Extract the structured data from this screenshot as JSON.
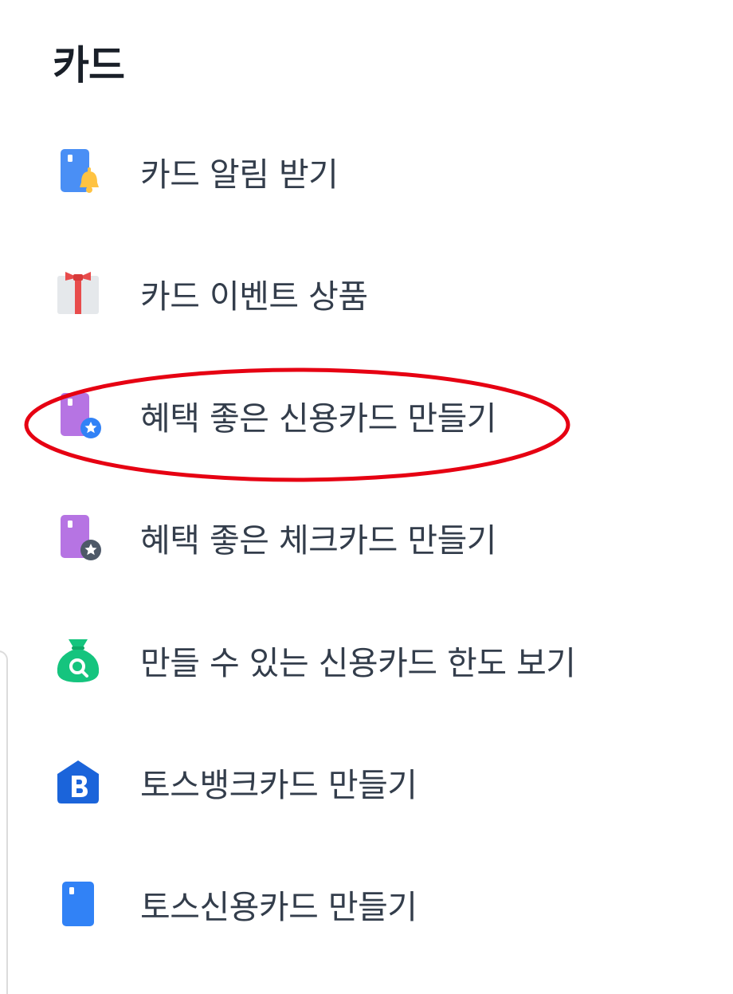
{
  "section": {
    "title": "카드"
  },
  "menu": {
    "items": [
      {
        "label": "카드 알림 받기",
        "icon": "card-bell-icon"
      },
      {
        "label": "카드 이벤트 상품",
        "icon": "gift-icon"
      },
      {
        "label": "혜택 좋은 신용카드 만들기",
        "icon": "credit-card-star-icon"
      },
      {
        "label": "혜택 좋은 체크카드 만들기",
        "icon": "check-card-star-icon"
      },
      {
        "label": "만들 수 있는 신용카드 한도 보기",
        "icon": "money-bag-search-icon"
      },
      {
        "label": "토스뱅크카드 만들기",
        "icon": "toss-bank-b-icon"
      },
      {
        "label": "토스신용카드 만들기",
        "icon": "toss-card-icon"
      }
    ]
  },
  "colors": {
    "title_text": "#191f28",
    "item_text": "#333d4b",
    "highlight": "#e60012",
    "blue": "#3182f6",
    "purple": "#a867e0",
    "green": "#15c47e",
    "bell_yellow": "#ffc342"
  }
}
